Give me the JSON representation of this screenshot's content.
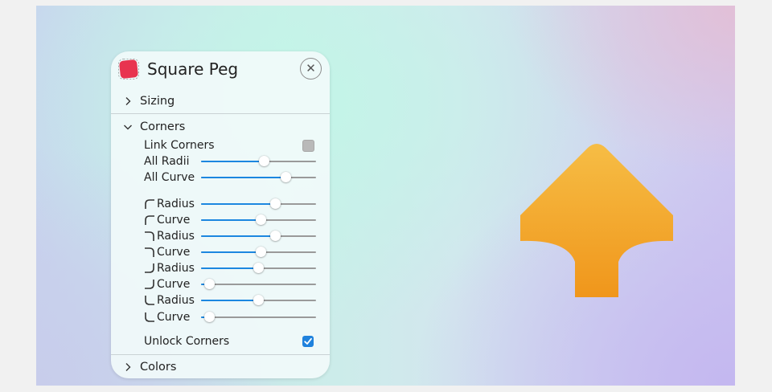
{
  "panel": {
    "title": "Square Peg",
    "logo_icon": "app-logo-icon",
    "close_icon": "close-icon",
    "close_glyph": "✕",
    "accent_color": "#1c87e0",
    "sections": {
      "sizing": "Sizing",
      "corners": "Corners",
      "colors": "Colors"
    },
    "link_corners": {
      "label": "Link Corners",
      "checked": false
    },
    "all_radii": {
      "label": "All Radii",
      "value": 0.55
    },
    "all_curve": {
      "label": "All Curve",
      "value": 0.74
    },
    "corner_controls": [
      {
        "corner": "top-left",
        "icon": "top-left-corner-icon",
        "label": "Radius",
        "value": 0.65
      },
      {
        "corner": "top-left",
        "icon": "top-left-corner-icon",
        "label": "Curve",
        "value": 0.52
      },
      {
        "corner": "top-right",
        "icon": "top-right-corner-icon",
        "label": "Radius",
        "value": 0.65
      },
      {
        "corner": "top-right",
        "icon": "top-right-corner-icon",
        "label": "Curve",
        "value": 0.52
      },
      {
        "corner": "bottom-right",
        "icon": "bottom-right-corner-icon",
        "label": "Radius",
        "value": 0.5
      },
      {
        "corner": "bottom-right",
        "icon": "bottom-right-corner-icon",
        "label": "Curve",
        "value": 0.07
      },
      {
        "corner": "bottom-left",
        "icon": "bottom-left-corner-icon",
        "label": "Radius",
        "value": 0.5
      },
      {
        "corner": "bottom-left",
        "icon": "bottom-left-corner-icon",
        "label": "Curve",
        "value": 0.07
      }
    ],
    "unlock_corners": {
      "label": "Unlock Corners",
      "checked": true
    }
  },
  "preview": {
    "shape_colors": {
      "top": "#f6bd45",
      "bottom": "#f0961b"
    }
  }
}
